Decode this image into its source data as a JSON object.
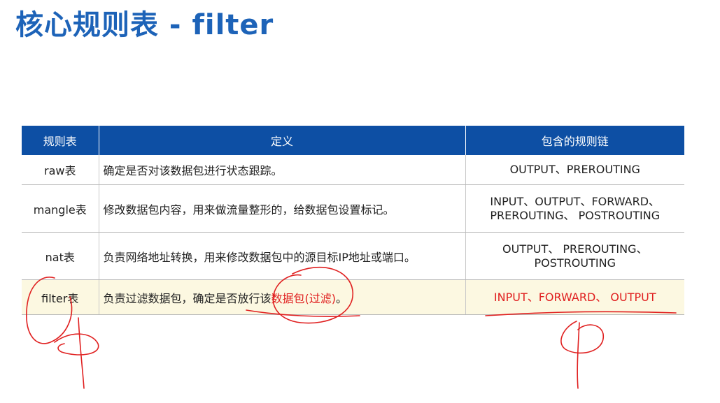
{
  "title": "核心规则表 - filter",
  "table": {
    "headers": [
      "规则表",
      "定义",
      "包含的规则链"
    ],
    "rows": [
      {
        "name": "raw表",
        "definition": "确定是否对该数据包进行状态跟踪。",
        "chains": [
          "OUTPUT、PREROUTING"
        ]
      },
      {
        "name": "mangle表",
        "definition": "修改数据包内容，用来做流量整形的，给数据包设置标记。",
        "chains": [
          "INPUT、OUTPUT、FORWARD、",
          "PREROUTING、 POSTROUTING"
        ]
      },
      {
        "name": "nat表",
        "definition": "负责网络地址转换，用来修改数据包中的源目标IP地址或端口。",
        "chains": [
          "OUTPUT、 PREROUTING、",
          "POSTROUTING"
        ]
      },
      {
        "name": "filter表",
        "definition_prefix": "负责过滤数据包，确定是否放行该",
        "definition_highlight": "数据包(过滤)",
        "definition_suffix": "。",
        "chains": [
          "INPUT、FORWARD、 OUTPUT"
        ]
      }
    ]
  },
  "colors": {
    "title": "#1d63b8",
    "header_bg": "#0d4fa4",
    "highlight_row_bg": "#fcf8e1",
    "highlight_text": "#e02020",
    "annotation_ink": "#e02020"
  }
}
